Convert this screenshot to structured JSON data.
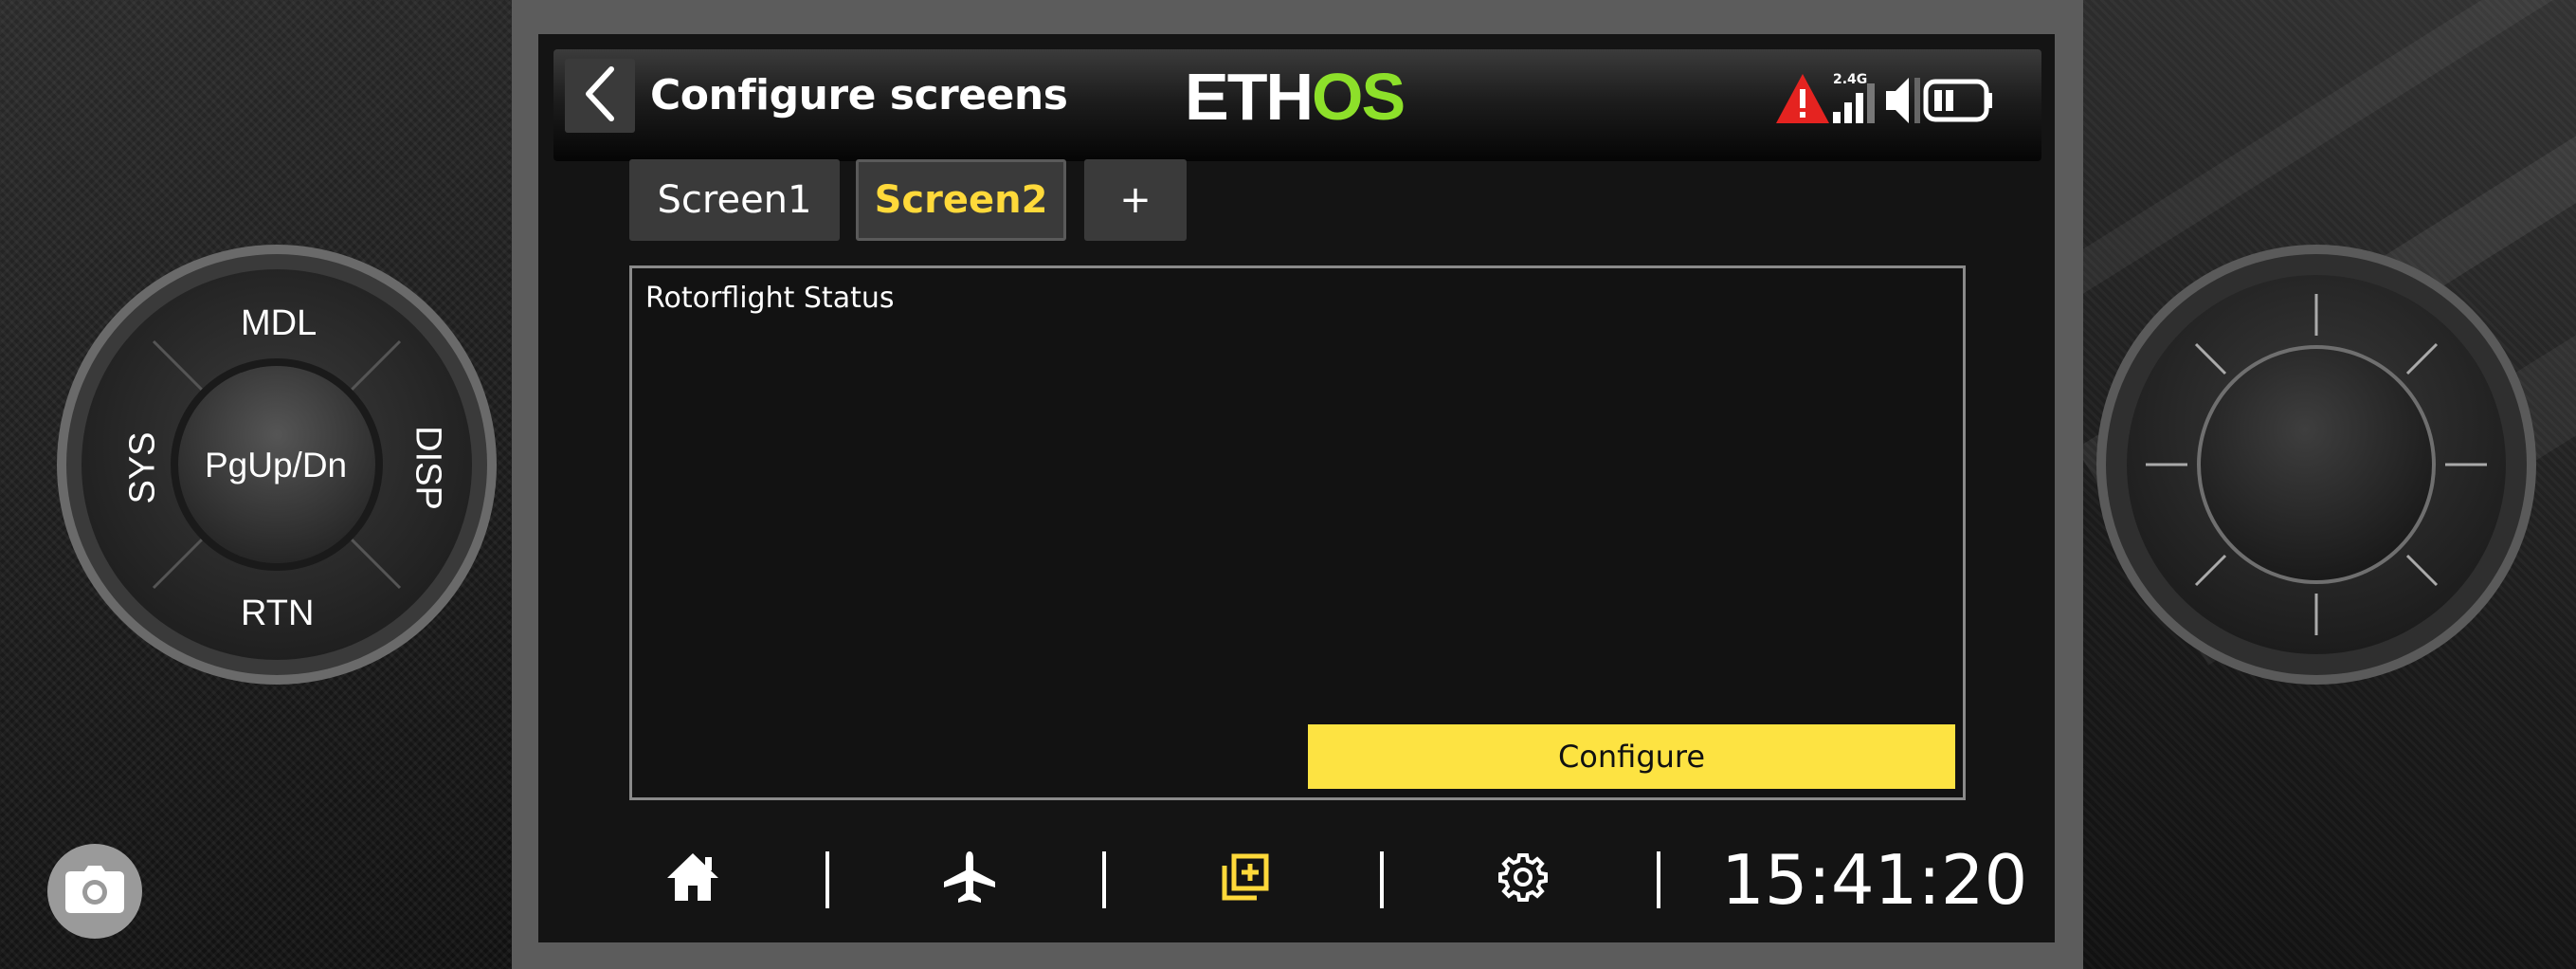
{
  "device": {
    "dpad": {
      "top": "MDL",
      "left": "SYS",
      "center": "PgUp/Dn",
      "right": "DISP",
      "bottom": "RTN"
    },
    "camera_icon": "camera-icon",
    "knob_icon": "rotary-knob"
  },
  "header": {
    "back_icon": "chevron-left-icon",
    "title": "Configure screens",
    "logo_part1": "ETH",
    "logo_part2": "OS",
    "status": {
      "warning_icon": "warning-icon",
      "signal_label": "2.4G",
      "signal_icon": "signal-bars-icon",
      "volume_icon": "speaker-icon",
      "battery_icon": "battery-icon"
    }
  },
  "tabs": [
    {
      "label": "Screen1",
      "active": false
    },
    {
      "label": "Screen2",
      "active": true
    },
    {
      "label": "+",
      "active": false
    }
  ],
  "widget": {
    "label": "Rotorflight Status",
    "configure_label": "Configure"
  },
  "nav": {
    "items": [
      "home-icon",
      "airplane-icon",
      "screens-icon",
      "gear-icon"
    ],
    "clock": "15:41:20"
  },
  "colors": {
    "accent": "#fde342",
    "active_tab_text": "#ffd93a",
    "logo_green": "#8de02a",
    "warning": "#e52320"
  }
}
